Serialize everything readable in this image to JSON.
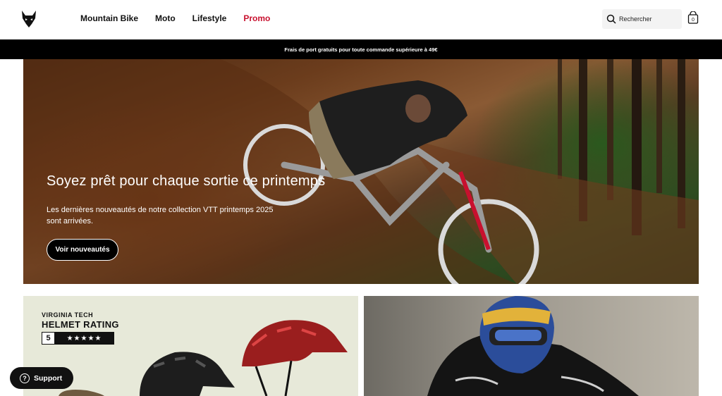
{
  "header": {
    "nav": [
      "Mountain Bike",
      "Moto",
      "Lifestyle",
      "Promo"
    ],
    "search_placeholder": "Rechercher",
    "cart_count": "0"
  },
  "banner": {
    "text": "Frais de port gratuits pour toute commande supérieure à 49€"
  },
  "hero": {
    "title": "Soyez prêt pour chaque sortie ce printemps",
    "description": "Les dernières nouveautés de notre collection VTT printemps 2025 sont arrivées.",
    "button": "Voir nouveautés"
  },
  "tile_left": {
    "rating_top": "VIRGINIA TECH",
    "rating_main": "HELMET RATING",
    "rating_number": "5",
    "rating_stars": "★★★★★"
  },
  "support": {
    "label": "Support",
    "icon": "?"
  },
  "colors": {
    "promo": "#c8102e",
    "banner": "#000000",
    "accent": "#111111"
  }
}
